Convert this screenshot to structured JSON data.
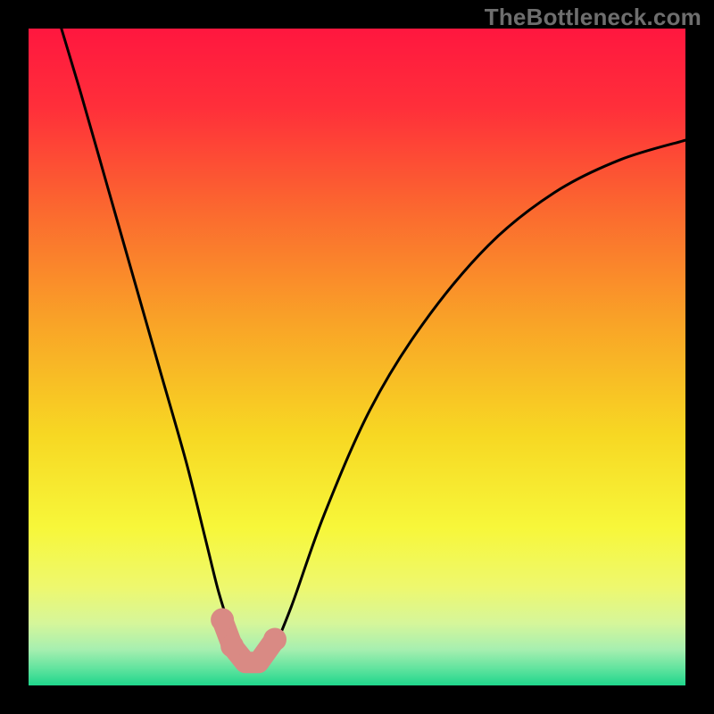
{
  "watermark": "TheBottleneck.com",
  "colors": {
    "frame": "#000000",
    "curve": "#000000",
    "marker_fill": "#d98a84",
    "marker_stroke": "#c77670",
    "gradient_stops": [
      {
        "offset": 0.0,
        "color": "#ff173f"
      },
      {
        "offset": 0.12,
        "color": "#ff2f3a"
      },
      {
        "offset": 0.28,
        "color": "#fb6a2f"
      },
      {
        "offset": 0.45,
        "color": "#f9a427"
      },
      {
        "offset": 0.62,
        "color": "#f7d823"
      },
      {
        "offset": 0.76,
        "color": "#f7f73a"
      },
      {
        "offset": 0.85,
        "color": "#eef86e"
      },
      {
        "offset": 0.905,
        "color": "#d6f69a"
      },
      {
        "offset": 0.945,
        "color": "#a7efb0"
      },
      {
        "offset": 0.975,
        "color": "#5fe39e"
      },
      {
        "offset": 1.0,
        "color": "#1fd68c"
      }
    ]
  },
  "chart_data": {
    "type": "line",
    "title": "",
    "xlabel": "",
    "ylabel": "",
    "xlim": [
      0,
      100
    ],
    "ylim": [
      0,
      100
    ],
    "grid": false,
    "annotations": [
      "TheBottleneck.com"
    ],
    "series": [
      {
        "name": "bottleneck-curve",
        "x": [
          5,
          8,
          12,
          16,
          20,
          24,
          27,
          29,
          31,
          33,
          35,
          37,
          40,
          45,
          52,
          60,
          70,
          80,
          90,
          100
        ],
        "y": [
          100,
          90,
          76,
          62,
          48,
          34,
          22,
          14,
          8,
          4,
          3,
          5,
          12,
          26,
          42,
          55,
          67,
          75,
          80,
          83
        ]
      }
    ],
    "markers": {
      "name": "highlight-region",
      "points": [
        {
          "x": 29.5,
          "y": 10
        },
        {
          "x": 31,
          "y": 6
        },
        {
          "x": 33,
          "y": 3.5
        },
        {
          "x": 35,
          "y": 3.5
        },
        {
          "x": 37.5,
          "y": 7
        }
      ]
    }
  }
}
